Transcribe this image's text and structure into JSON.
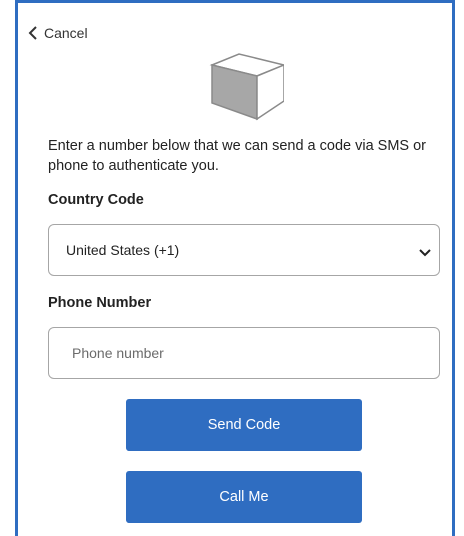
{
  "nav": {
    "cancel_label": "Cancel"
  },
  "logo": {
    "icon": "cube-icon"
  },
  "instructions": "Enter a number below that we can send a code via SMS or phone to authenticate you.",
  "country": {
    "label": "Country Code",
    "selected": "United States (+1)"
  },
  "phone": {
    "label": "Phone Number",
    "placeholder": "Phone number",
    "value": ""
  },
  "buttons": {
    "send_code": "Send Code",
    "call_me": "Call Me"
  },
  "colors": {
    "accent": "#2f6dc1",
    "border": "#a6a6a6",
    "text": "#222222"
  }
}
